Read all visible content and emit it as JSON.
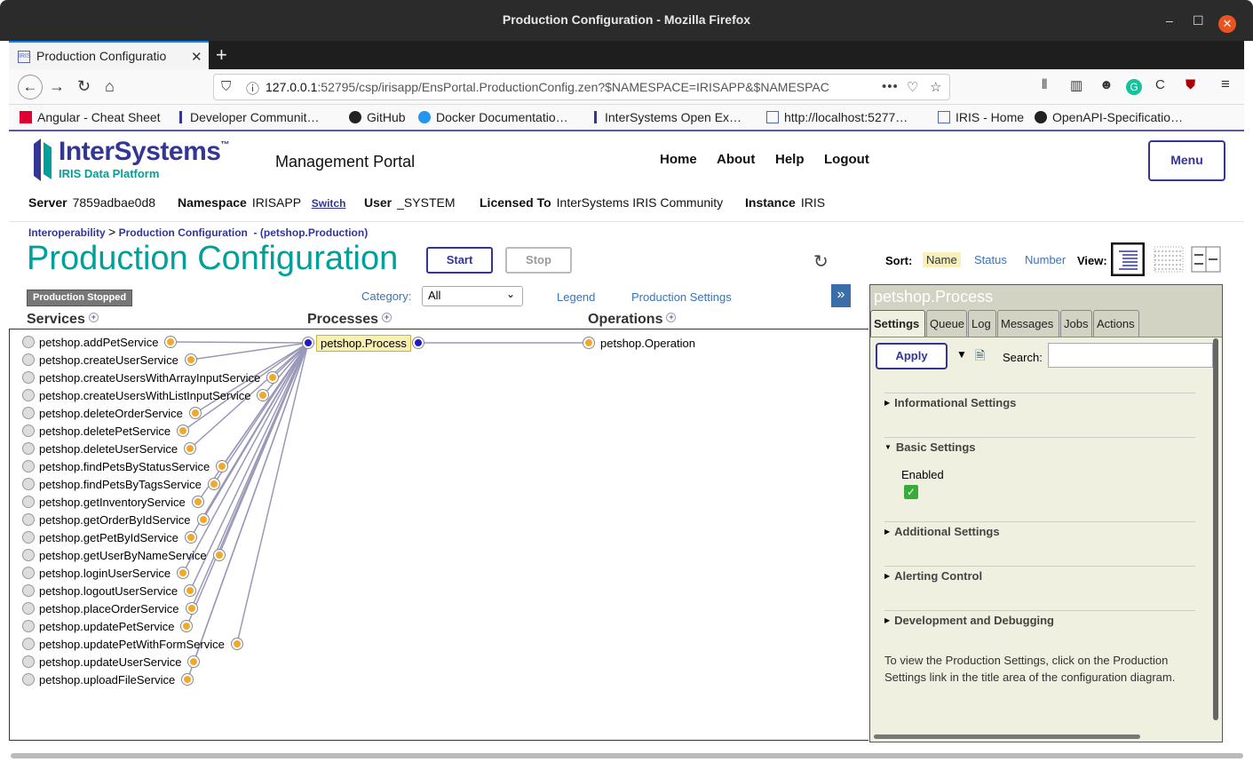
{
  "window": {
    "title": "Production Configuration - Mozilla Firefox"
  },
  "tab": {
    "label": "Production Configuratio",
    "favicon": "IRIS"
  },
  "urlbar": {
    "host": "127.0.0.1",
    "rest": ":52795/csp/irisapp/EnsPortal.ProductionConfig.zen?$NAMESPACE=IRISAPP&$NAMESPAC"
  },
  "bookmarks": [
    "Angular - Cheat Sheet",
    "Developer Communit…",
    "GitHub",
    "Docker Documentatio…",
    "InterSystems Open Ex…",
    "http://localhost:5277…",
    "IRIS - Home",
    "OpenAPI-Specificatio…"
  ],
  "portal": {
    "logo_title": "InterSystems",
    "logo_tm": "™",
    "logo_subtitle": "IRIS Data Platform",
    "name": "Management Portal",
    "links": {
      "home": "Home",
      "about": "About",
      "help": "Help",
      "logout": "Logout"
    },
    "menu": "Menu",
    "info": {
      "server_label": "Server",
      "server": "7859adbae0d8",
      "namespace_label": "Namespace",
      "namespace": "IRISAPP",
      "switch": "Switch",
      "user_label": "User",
      "user": "_SYSTEM",
      "licensed_label": "Licensed To",
      "licensed": "InterSystems IRIS Community",
      "instance_label": "Instance",
      "instance": "IRIS"
    }
  },
  "breadcrumb": {
    "a": "Interoperability",
    "sep": ">",
    "b": "Production Configuration",
    "suffix": "- (petshop.Production)"
  },
  "page_title": "Production Configuration",
  "buttons": {
    "start": "Start",
    "stop": "Stop"
  },
  "sort": {
    "label": "Sort:",
    "name": "Name",
    "status": "Status",
    "number": "Number"
  },
  "view": {
    "label": "View:"
  },
  "diagram": {
    "status": "Production Stopped",
    "category_label": "Category:",
    "category_value": "All",
    "legend": "Legend",
    "production_settings": "Production Settings",
    "expand": "»",
    "col_services": "Services",
    "col_processes": "Processes",
    "col_operations": "Operations",
    "process": "petshop.Process",
    "operation": "petshop.Operation",
    "services": [
      "petshop.addPetService",
      "petshop.createUserService",
      "petshop.createUsersWithArrayInputService",
      "petshop.createUsersWithListInputService",
      "petshop.deleteOrderService",
      "petshop.deletePetService",
      "petshop.deleteUserService",
      "petshop.findPetsByStatusService",
      "petshop.findPetsByTagsService",
      "petshop.getInventoryService",
      "petshop.getOrderByIdService",
      "petshop.getPetByIdService",
      "petshop.getUserByNameService",
      "petshop.loginUserService",
      "petshop.logoutUserService",
      "petshop.placeOrderService",
      "petshop.updatePetService",
      "petshop.updatePetWithFormService",
      "petshop.updateUserService",
      "petshop.uploadFileService"
    ]
  },
  "panel": {
    "title": "petshop.Process",
    "tabs": [
      "Settings",
      "Queue",
      "Log",
      "Messages",
      "Jobs",
      "Actions"
    ],
    "apply": "Apply",
    "search_label": "Search:",
    "search_value": "",
    "sections": {
      "informational": "Informational Settings",
      "basic": "Basic Settings",
      "additional": "Additional Settings",
      "alerting": "Alerting Control",
      "development": "Development and Debugging"
    },
    "enabled_label": "Enabled",
    "enabled": true,
    "help": "To view the Production Settings, click on the Production Settings link in the title area of the configuration diagram."
  },
  "colors": {
    "accent": "#00a09a",
    "brand": "#333695",
    "link": "#3b73b9",
    "port": "#f3a82a",
    "port_blue": "#1a1ac8"
  }
}
